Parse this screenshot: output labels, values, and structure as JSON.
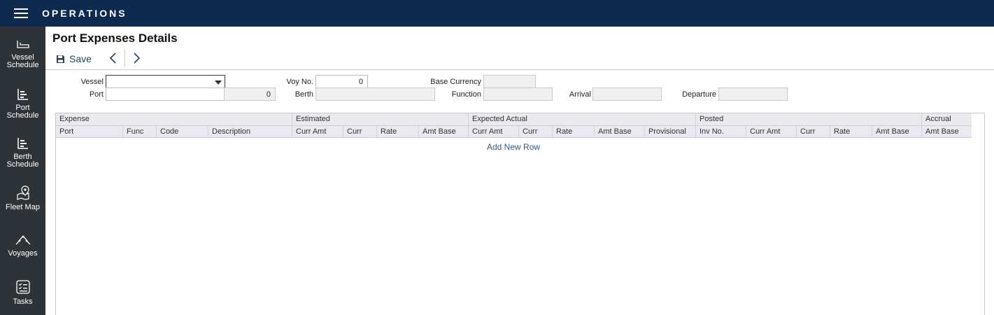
{
  "app": {
    "title": "OPERATIONS"
  },
  "sidebar": {
    "items": [
      {
        "label_1": "Vessel",
        "label_2": "Schedule",
        "icon": "vessel-icon"
      },
      {
        "label_1": "Port",
        "label_2": "Schedule",
        "icon": "port-schedule-icon"
      },
      {
        "label_1": "Berth",
        "label_2": "Schedule",
        "icon": "berth-schedule-icon"
      },
      {
        "label_1": "Fleet Map",
        "label_2": "",
        "icon": "map-pin-icon"
      },
      {
        "label_1": "Voyages",
        "label_2": "",
        "icon": "voyages-icon"
      },
      {
        "label_1": "Tasks",
        "label_2": "",
        "icon": "tasks-icon"
      }
    ]
  },
  "page": {
    "title": "Port Expenses Details"
  },
  "toolbar": {
    "save_label": "Save"
  },
  "form": {
    "vessel_label": "Vessel",
    "vessel_value": "",
    "port_label": "Port",
    "port_value": "",
    "port_number": "0",
    "voy_label": "Voy No.",
    "voy_value": "0",
    "berth_label": "Berth",
    "berth_value": "",
    "base_currency_label": "Base Currency",
    "base_currency_value": "",
    "function_label": "Function",
    "function_value": "",
    "arrival_label": "Arrival",
    "arrival_value": "",
    "departure_label": "Departure",
    "departure_value": ""
  },
  "grid": {
    "groups": [
      "Expense",
      "Estimated",
      "Expected Actual",
      "Posted",
      "Accrual"
    ],
    "columns": [
      "Port",
      "Func",
      "Code",
      "Description",
      "Curr Amt",
      "Curr",
      "Rate",
      "Amt Base",
      "Curr Amt",
      "Curr",
      "Rate",
      "Amt Base",
      "Provisional",
      "Inv No.",
      "Curr Amt",
      "Curr",
      "Rate",
      "Amt Base",
      "Amt Base"
    ],
    "add_row_label": "Add New Row"
  }
}
